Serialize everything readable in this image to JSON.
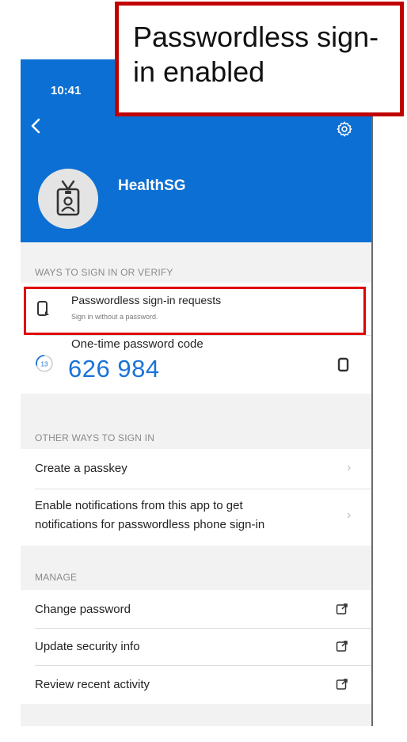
{
  "status_bar": {
    "time": "10:41"
  },
  "account": {
    "name": "HealthSG"
  },
  "ways_section": {
    "label": "WAYS TO SIGN IN OR VERIFY",
    "passwordless": {
      "title": "Passwordless sign-in requests",
      "subtitle": "Sign in without a password."
    },
    "otp": {
      "title": "One-time password code",
      "code": "626 984",
      "timer": "13"
    }
  },
  "other_section": {
    "label": "OTHER WAYS TO SIGN IN",
    "items": [
      {
        "label": "Create a passkey"
      },
      {
        "label_line1": "Enable notifications from this app to get",
        "label_line2": "notifications for passwordless phone sign-in"
      }
    ]
  },
  "manage_section": {
    "label": "MANAGE",
    "items": [
      {
        "label": "Change password"
      },
      {
        "label": "Update security info"
      },
      {
        "label": "Review recent activity"
      }
    ]
  },
  "callout": {
    "text": "Passwordless sign-in enabled"
  },
  "colors": {
    "brand_blue": "#0c6fd3",
    "code_blue": "#1a73d9",
    "highlight_red": "#e00000",
    "callout_red": "#c00000"
  },
  "icons": [
    "back-chevron-icon",
    "gear-icon",
    "badge-icon",
    "phone-icon",
    "timer-icon",
    "copy-icon",
    "chevron-right-icon",
    "external-link-icon"
  ]
}
